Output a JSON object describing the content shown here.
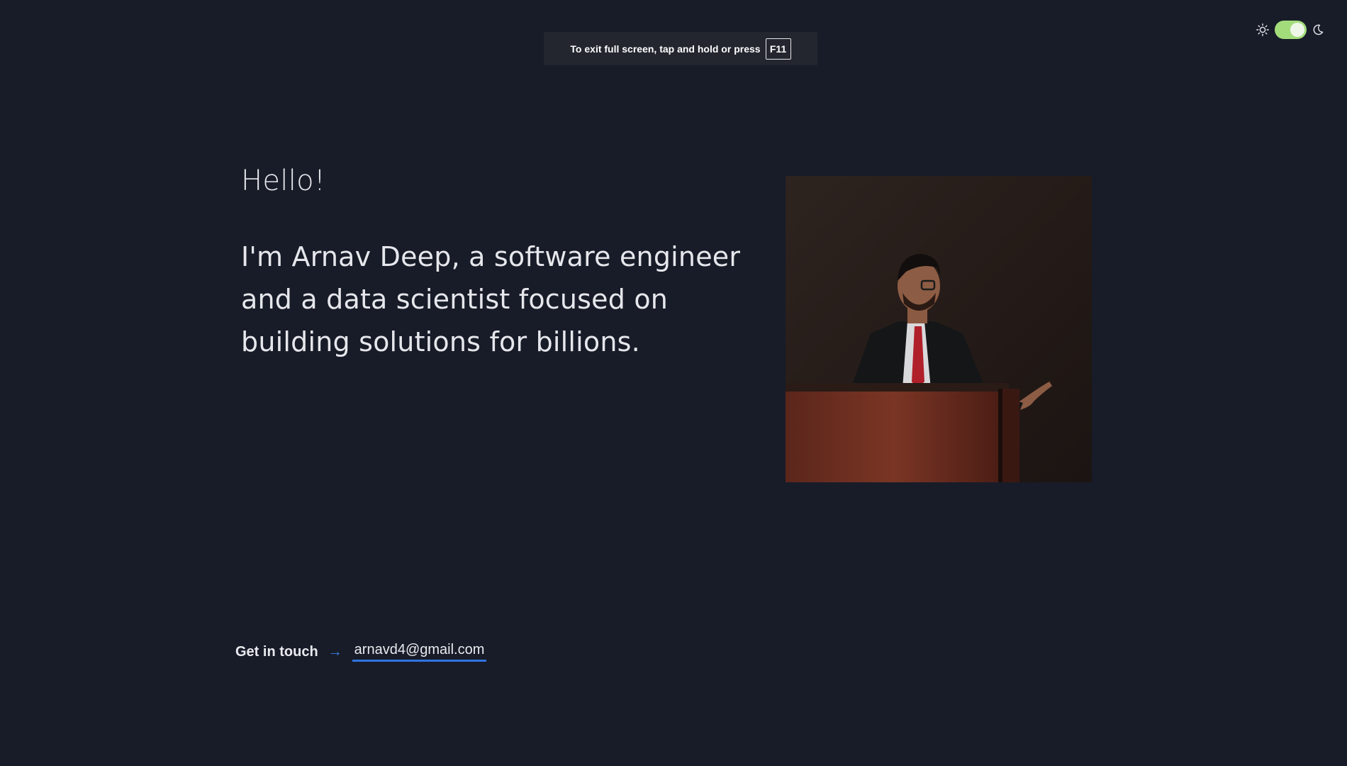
{
  "fullscreen_toast": {
    "message": "To exit full screen, tap and hold or press",
    "key": "F11"
  },
  "theme_toggle": {
    "left_icon": "sun-icon",
    "right_icon": "moon-icon",
    "state": "on",
    "accent_color": "#a3dd7b"
  },
  "hero": {
    "greeting": "Hello!",
    "intro": "I'm Arnav Deep, a software engineer and a data scientist focused on building solutions for billions."
  },
  "portrait": {
    "description_icon": "portrait-photo"
  },
  "contact": {
    "label": "Get in touch",
    "arrow": "→",
    "email": "arnavd4@gmail.com",
    "link_color": "#2e74e0"
  },
  "colors": {
    "background": "#181c28",
    "text": "#e6e7ec"
  }
}
